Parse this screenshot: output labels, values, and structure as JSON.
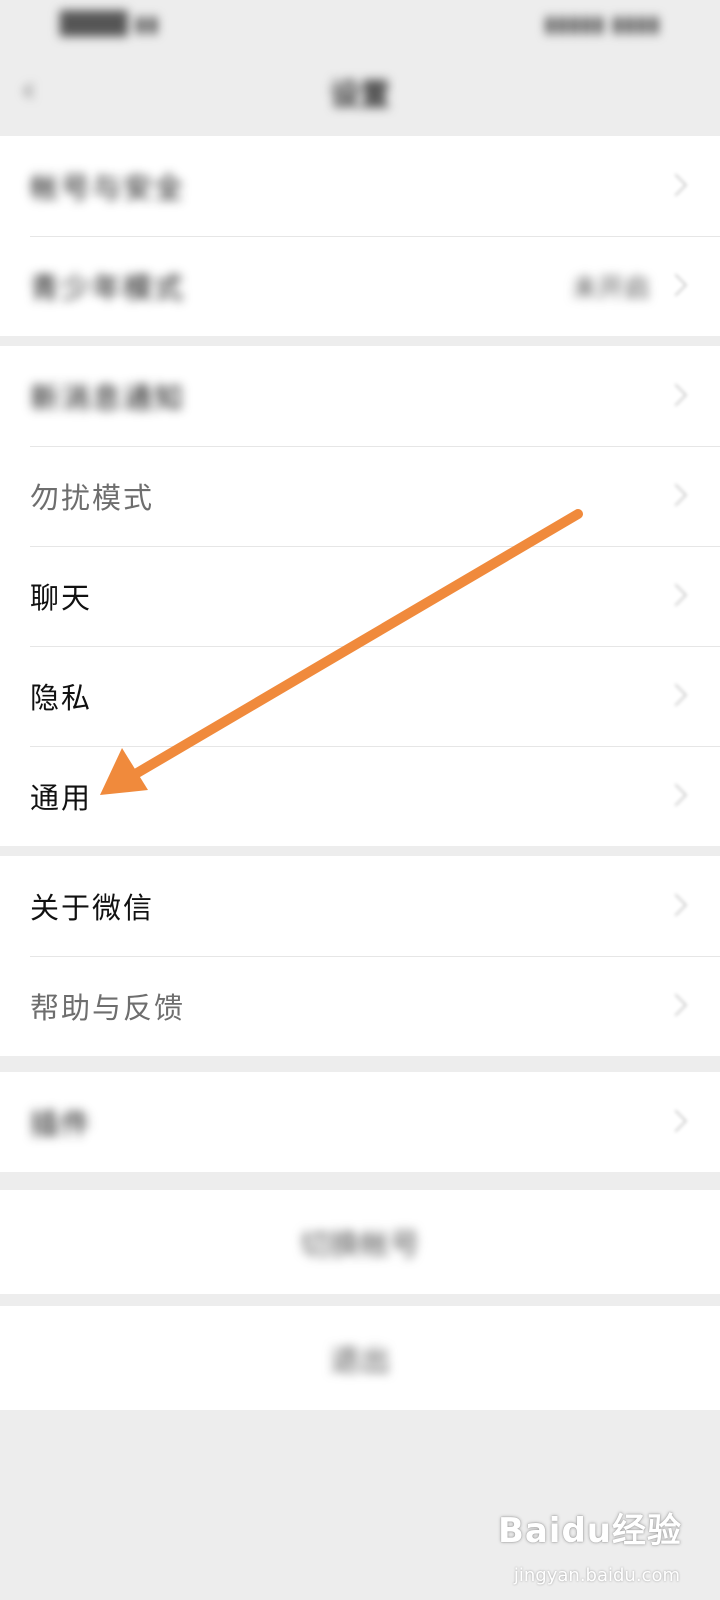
{
  "status_bar": {
    "left": "████ ▮▮",
    "right": "▮▮▮▮▮ ▮▮▮▮"
  },
  "header": {
    "back_icon": "back-arrow-icon",
    "title": "设置"
  },
  "groups": [
    {
      "items": [
        {
          "label": "帐号与安全"
        },
        {
          "label": "青少年模式",
          "value": "未开启"
        }
      ]
    },
    {
      "items": [
        {
          "label": "新消息通知"
        },
        {
          "label": "勿扰模式"
        },
        {
          "label": "聊天"
        },
        {
          "label": "隐私"
        },
        {
          "label": "通用"
        }
      ]
    },
    {
      "items": [
        {
          "label": "关于微信"
        },
        {
          "label": "帮助与反馈"
        }
      ]
    },
    {
      "items": [
        {
          "label": "插件"
        }
      ]
    }
  ],
  "actions": {
    "switch_account": "切换帐号",
    "logout": "退出"
  },
  "annotation": {
    "arrow_color": "#f08a3c",
    "points_to": "通用"
  },
  "watermark": {
    "logo": "Baidu经验",
    "url": "jingyan.baidu.com"
  },
  "colors": {
    "background": "#ededed",
    "card": "#ffffff",
    "arrow": "#f08a3c"
  }
}
